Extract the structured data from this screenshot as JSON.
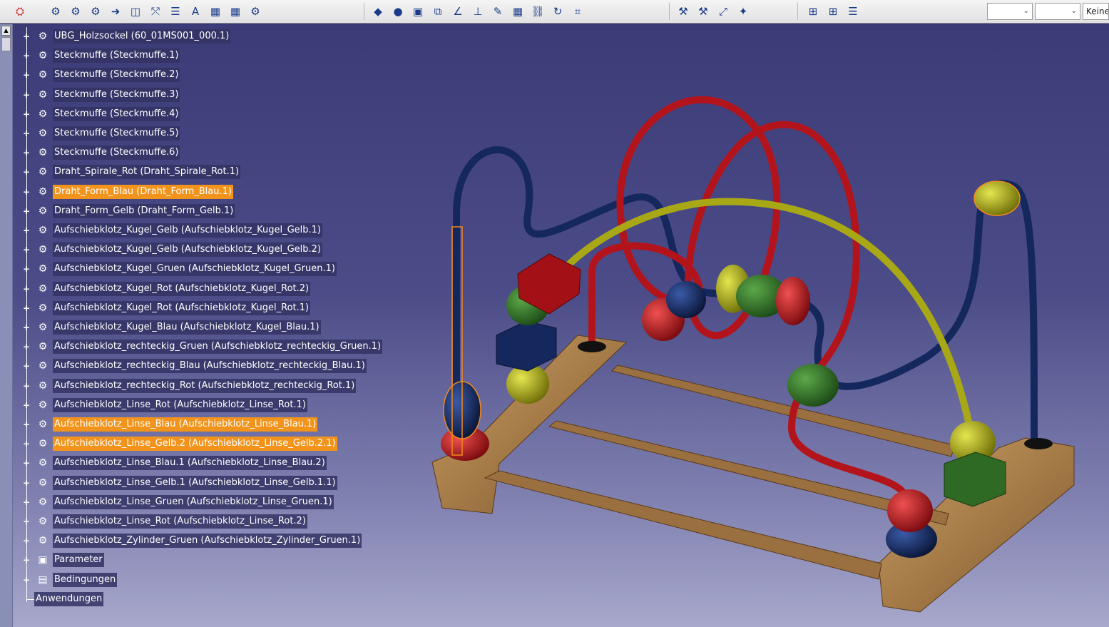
{
  "toolbar": {
    "icons": [
      "gear-icon",
      "gear-icon",
      "gear-icon",
      "arrow-icon",
      "diagram-icon",
      "graph-icon",
      "list-icon",
      "text-icon",
      "table-icon",
      "table-icon",
      "gear-icon",
      "shape-icon",
      "sphere-icon",
      "box-icon",
      "assembly-icon",
      "angle-icon",
      "clamp-icon",
      "pencil-icon",
      "grid-icon",
      "link-icon",
      "refresh-icon",
      "mesh-icon",
      "tool-icon",
      "tool-icon",
      "zoom-fit-icon",
      "star-icon",
      "tree-icon",
      "tree-icon",
      "list-icon"
    ],
    "combo_1": "",
    "combo_2": "",
    "combo_3": "Keine"
  },
  "tree": {
    "nodes": [
      {
        "label": "UBG_Holzsockel (60_01MS001_000.1)",
        "selected": false,
        "icon": "part-icon"
      },
      {
        "label": "Steckmuffe (Steckmuffe.1)",
        "selected": false,
        "icon": "part-icon"
      },
      {
        "label": "Steckmuffe (Steckmuffe.2)",
        "selected": false,
        "icon": "part-icon"
      },
      {
        "label": "Steckmuffe (Steckmuffe.3)",
        "selected": false,
        "icon": "part-icon"
      },
      {
        "label": "Steckmuffe (Steckmuffe.4)",
        "selected": false,
        "icon": "part-icon"
      },
      {
        "label": "Steckmuffe (Steckmuffe.5)",
        "selected": false,
        "icon": "part-icon"
      },
      {
        "label": "Steckmuffe (Steckmuffe.6)",
        "selected": false,
        "icon": "part-icon"
      },
      {
        "label": "Draht_Spirale_Rot (Draht_Spirale_Rot.1)",
        "selected": false,
        "icon": "part-icon"
      },
      {
        "label": "Draht_Form_Blau (Draht_Form_Blau.1)",
        "selected": true,
        "icon": "part-icon"
      },
      {
        "label": "Draht_Form_Gelb (Draht_Form_Gelb.1)",
        "selected": false,
        "icon": "part-icon"
      },
      {
        "label": "Aufschiebklotz_Kugel_Gelb (Aufschiebklotz_Kugel_Gelb.1)",
        "selected": false,
        "icon": "part-icon"
      },
      {
        "label": "Aufschiebklotz_Kugel_Gelb (Aufschiebklotz_Kugel_Gelb.2)",
        "selected": false,
        "icon": "part-icon"
      },
      {
        "label": "Aufschiebklotz_Kugel_Gruen (Aufschiebklotz_Kugel_Gruen.1)",
        "selected": false,
        "icon": "part-icon"
      },
      {
        "label": "Aufschiebklotz_Kugel_Rot (Aufschiebklotz_Kugel_Rot.2)",
        "selected": false,
        "icon": "part-icon"
      },
      {
        "label": "Aufschiebklotz_Kugel_Rot (Aufschiebklotz_Kugel_Rot.1)",
        "selected": false,
        "icon": "part-icon"
      },
      {
        "label": "Aufschiebklotz_Kugel_Blau (Aufschiebklotz_Kugel_Blau.1)",
        "selected": false,
        "icon": "part-icon"
      },
      {
        "label": "Aufschiebklotz_rechteckig_Gruen (Aufschiebklotz_rechteckig_Gruen.1)",
        "selected": false,
        "icon": "part-icon"
      },
      {
        "label": "Aufschiebklotz_rechteckig_Blau (Aufschiebklotz_rechteckig_Blau.1)",
        "selected": false,
        "icon": "part-icon"
      },
      {
        "label": "Aufschiebklotz_rechteckig_Rot (Aufschiebklotz_rechteckig_Rot.1)",
        "selected": false,
        "icon": "part-icon"
      },
      {
        "label": "Aufschiebklotz_Linse_Rot (Aufschiebklotz_Linse_Rot.1)",
        "selected": false,
        "icon": "part-icon"
      },
      {
        "label": "Aufschiebklotz_Linse_Blau (Aufschiebklotz_Linse_Blau.1)",
        "selected": true,
        "icon": "part-icon"
      },
      {
        "label": "Aufschiebklotz_Linse_Gelb.2 (Aufschiebklotz_Linse_Gelb.2.1)",
        "selected": true,
        "icon": "part-icon"
      },
      {
        "label": "Aufschiebklotz_Linse_Blau.1 (Aufschiebklotz_Linse_Blau.2)",
        "selected": false,
        "icon": "part-icon"
      },
      {
        "label": "Aufschiebklotz_Linse_Gelb.1 (Aufschiebklotz_Linse_Gelb.1.1)",
        "selected": false,
        "icon": "part-icon"
      },
      {
        "label": "Aufschiebklotz_Linse_Gruen (Aufschiebklotz_Linse_Gruen.1)",
        "selected": false,
        "icon": "part-icon"
      },
      {
        "label": "Aufschiebklotz_Linse_Rot (Aufschiebklotz_Linse_Rot.2)",
        "selected": false,
        "icon": "part-icon"
      },
      {
        "label": "Aufschiebklotz_Zylinder_Gruen (Aufschiebklotz_Zylinder_Gruen.1)",
        "selected": false,
        "icon": "part-icon"
      },
      {
        "label": "Parameter",
        "selected": false,
        "icon": "parameter-icon"
      },
      {
        "label": "Bedingungen",
        "selected": false,
        "icon": "constraints-icon"
      },
      {
        "label": "Anwendungen",
        "selected": false,
        "icon": "none"
      }
    ]
  },
  "colors": {
    "selection": "#f2941c",
    "wire_red": "#b3141b",
    "wire_blue": "#14285e",
    "wire_yellow": "#a8a817",
    "wood": "#a57b47"
  }
}
